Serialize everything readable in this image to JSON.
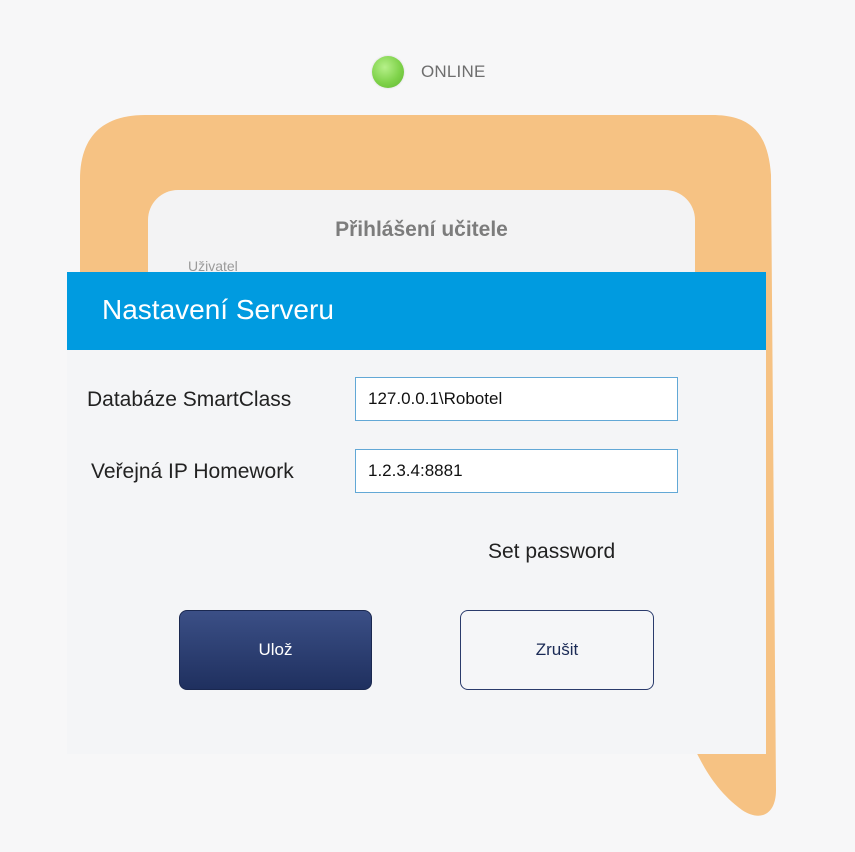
{
  "status": {
    "label": "ONLINE",
    "state_color": "#7fd24a"
  },
  "login_card": {
    "title": "Přihlášení učitele",
    "partial_label": "Uživatel"
  },
  "dialog": {
    "title": "Nastavení Serveru",
    "fields": [
      {
        "label": "Databáze SmartClass",
        "value": "127.0.0.1\\Robotel"
      },
      {
        "label": "Veřejná IP Homework",
        "value": "1.2.3.4:8881"
      }
    ],
    "set_password_link": "Set password",
    "save_label": "Ulož",
    "cancel_label": "Zrušit"
  },
  "colors": {
    "header_blue": "#009be0",
    "orange_frame": "#f6c283",
    "save_button": "#2a3b6c"
  }
}
